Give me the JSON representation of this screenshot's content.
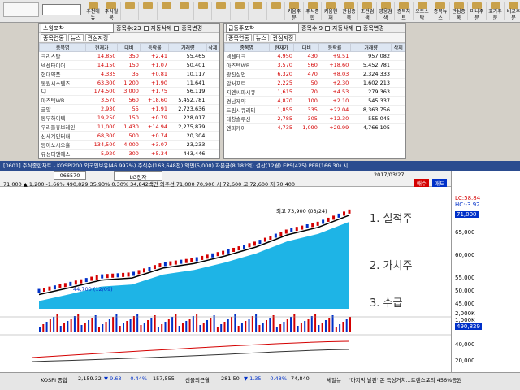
{
  "topbar": {
    "search_placeholder": "",
    "buttons": [
      "추천메뉴",
      "주식월봉",
      "",
      "",
      "",
      "",
      "",
      "",
      "",
      "",
      "",
      "키움주문",
      "주식종합",
      "키움현재",
      "관심종목",
      "조건검색",
      "영웅검색",
      "종목차트",
      "오토스탁",
      "종목뉴스",
      "관심종목",
      "미니주문",
      "호가주문",
      "비교주문"
    ]
  },
  "left_panel": {
    "code": "스윙포착",
    "count_label": "종목수:23",
    "options": [
      "자동삭제",
      "종목변경",
      "이탈삭제",
      "등록"
    ],
    "tabs": [
      "종목연동",
      "뉴스",
      "관심저장",
      "검색",
      "신규",
      "설정"
    ],
    "columns": [
      "종목명",
      "현재가",
      "대비",
      "등락률",
      "거래량",
      "삭제"
    ],
    "rows": [
      {
        "name": "크리스탈",
        "price": "14,850",
        "diff": "350",
        "rate": "+2.41",
        "vol": "55,465",
        "dir": "up"
      },
      {
        "name": "넥센타이어",
        "price": "14,150",
        "diff": "150",
        "rate": "+1.07",
        "vol": "50,401",
        "dir": "up"
      },
      {
        "name": "현대약품",
        "price": "4,335",
        "diff": "35",
        "rate": "+0.81",
        "vol": "10,117",
        "dir": "up"
      },
      {
        "name": "동원시스템즈",
        "price": "63,300",
        "diff": "1,200",
        "rate": "+1.90",
        "vol": "11,641",
        "dir": "up"
      },
      {
        "name": "CJ",
        "price": "174,500",
        "diff": "3,000",
        "rate": "+1.75",
        "vol": "56,119",
        "dir": "up"
      },
      {
        "name": "아즈텍WB",
        "price": "3,570",
        "diff": "560",
        "rate": "+18.60",
        "vol": "5,452,781",
        "dir": "up"
      },
      {
        "name": "금양",
        "price": "2,930",
        "diff": "55",
        "rate": "+1.91",
        "vol": "2,723,636",
        "dir": "up"
      },
      {
        "name": "동부하이텍",
        "price": "19,250",
        "diff": "150",
        "rate": "+0.79",
        "vol": "228,017",
        "dir": "up"
      },
      {
        "name": "우리들휴브레인",
        "price": "11,000",
        "diff": "1,430",
        "rate": "+14.94",
        "vol": "2,275,879",
        "dir": "up"
      },
      {
        "name": "신세계인터내",
        "price": "68,300",
        "diff": "500",
        "rate": "+0.74",
        "vol": "20,304",
        "dir": "up"
      },
      {
        "name": "동아쏘시오홀",
        "price": "134,500",
        "diff": "4,000",
        "rate": "+3.07",
        "vol": "23,233",
        "dir": "up"
      },
      {
        "name": "유성티앤에스",
        "price": "5,920",
        "diff": "300",
        "rate": "+5.34",
        "vol": "443,446",
        "dir": "up"
      },
      {
        "name": "코오롱생명과",
        "price": "108,800",
        "diff": "2,000",
        "rate": "+1.87",
        "vol": "24,591",
        "dir": "up"
      }
    ]
  },
  "right_panel": {
    "code": "급등주포착",
    "count_label": "종목수:9",
    "options": [
      "자동삭제",
      "종목변경",
      "이탈삭제",
      "등록"
    ],
    "tabs": [
      "종목연동",
      "뉴스",
      "관심저장",
      "검색",
      "신규",
      "설정"
    ],
    "columns": [
      "종목명",
      "현재가",
      "대비",
      "등락률",
      "거래량",
      "삭제"
    ],
    "rows": [
      {
        "name": "넥센테크",
        "price": "4,950",
        "diff": "430",
        "rate": "+9.51",
        "vol": "957,082",
        "dir": "up"
      },
      {
        "name": "아즈텍WB",
        "price": "3,570",
        "diff": "560",
        "rate": "+18.60",
        "vol": "5,452,781",
        "dir": "up"
      },
      {
        "name": "광진실업",
        "price": "6,320",
        "diff": "470",
        "rate": "+8.03",
        "vol": "2,324,333",
        "dir": "up"
      },
      {
        "name": "알서포트",
        "price": "2,225",
        "diff": "50",
        "rate": "+2.30",
        "vol": "1,602,213",
        "dir": "up"
      },
      {
        "name": "지엔씨파시큐",
        "price": "1,615",
        "diff": "70",
        "rate": "+4.53",
        "vol": "279,363",
        "dir": "up"
      },
      {
        "name": "경남제약",
        "price": "4,870",
        "diff": "100",
        "rate": "+2.10",
        "vol": "545,337",
        "dir": "up"
      },
      {
        "name": "드림시큐리티",
        "price": "1,855",
        "diff": "335",
        "rate": "+22.04",
        "vol": "8,363,756",
        "dir": "up"
      },
      {
        "name": "대창솔루션",
        "price": "2,785",
        "diff": "305",
        "rate": "+12.30",
        "vol": "555,045",
        "dir": "up"
      },
      {
        "name": "엔피케이",
        "price": "4,735",
        "diff": "1,090",
        "rate": "+29.99",
        "vol": "4,766,105",
        "dir": "up"
      }
    ]
  },
  "chart": {
    "header": "[0601] 주식종합차트 - KOSPI200 외국인보유(46.997%) 주식수(163,648천) 액면(5,000) 자본금(8,182억) 결산(12월) EPS(425) PER(166.30) 시",
    "code": "066570",
    "name": "LG전자",
    "price_line": "71,000 ▲ 1,200 -1.66% 490,829 35.93% 0.30% 34,842백만 외주선 71,000 70,900 시 72,600 고 72,600 저 70,400",
    "date": "2017/03/27",
    "buy": "매수",
    "sell": "매도",
    "high_label": "최고 73,900 (03/24)",
    "low_label": "44,700 (12/09)",
    "right_axis": [
      "71,000",
      "65,000",
      "60,000",
      "55,000",
      "50,000",
      "45,000",
      "2,000K",
      "1,000K",
      "490,829",
      "40,000",
      "20,000"
    ],
    "lc": "LC:58.84",
    "hc": "HC:-3.92",
    "handwriting": [
      "1. 실적주",
      "2. 가치주",
      "3. 수급"
    ]
  },
  "chart_data": {
    "type": "line",
    "title": "LG전자",
    "xlabel": "",
    "ylabel": "",
    "x": [
      "12/09",
      "12/20",
      "01/03",
      "01/13",
      "01/24",
      "02/06",
      "02/16",
      "02/27",
      "03/09",
      "03/20",
      "03/27"
    ],
    "series": [
      {
        "values": [
          44700,
          47000,
          49500,
          50200,
          53500,
          55000,
          57500,
          60500,
          64500,
          67000,
          71000
        ]
      }
    ],
    "ylim": [
      40000,
      75000
    ]
  },
  "status": {
    "kospi_label": "KOSPI 종합",
    "kospi": "2,159.32",
    "kospi_diff": "▼ 9.63",
    "kospi_rate": "-0.44%",
    "kospi_vol": "157,555",
    "futures_label": "선물최근월",
    "futures": "281.50",
    "futures_diff": "▼ 1.35",
    "futures_rate": "-0.48%",
    "futures_vol": "74,840",
    "news_label": "세일뉴",
    "news": "'마지막 날판' 돈 득성거치...트렌스포티 456%등원"
  }
}
